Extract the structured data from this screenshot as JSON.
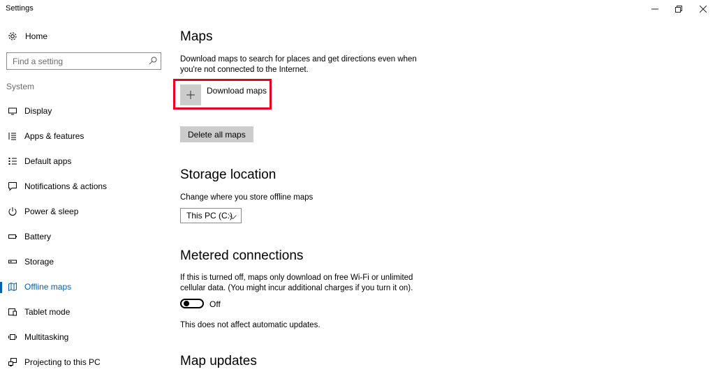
{
  "window": {
    "title": "Settings",
    "controls": {
      "minimize": "—",
      "maximize": "🗗",
      "close": "✕"
    }
  },
  "sidebar": {
    "home_label": "Home",
    "search_placeholder": "Find a setting",
    "section_label": "System",
    "items": [
      {
        "label": "Display",
        "icon": "display-icon"
      },
      {
        "label": "Apps & features",
        "icon": "apps-features-icon"
      },
      {
        "label": "Default apps",
        "icon": "default-apps-icon"
      },
      {
        "label": "Notifications & actions",
        "icon": "notifications-icon"
      },
      {
        "label": "Power & sleep",
        "icon": "power-icon"
      },
      {
        "label": "Battery",
        "icon": "battery-icon"
      },
      {
        "label": "Storage",
        "icon": "storage-icon"
      },
      {
        "label": "Offline maps",
        "icon": "offline-maps-icon",
        "active": true
      },
      {
        "label": "Tablet mode",
        "icon": "tablet-mode-icon"
      },
      {
        "label": "Multitasking",
        "icon": "multitasking-icon"
      },
      {
        "label": "Projecting to this PC",
        "icon": "projecting-icon"
      }
    ]
  },
  "main": {
    "maps": {
      "heading": "Maps",
      "description": "Download maps to search for places and get directions even when you're not connected to the Internet.",
      "download_label": "Download maps",
      "delete_label": "Delete all maps"
    },
    "storage": {
      "heading": "Storage location",
      "description": "Change where you store offline maps",
      "selected_drive": "This PC (C:)"
    },
    "metered": {
      "heading": "Metered connections",
      "description": "If this is turned off, maps only download on free Wi-Fi or unlimited cellular data. (You might incur additional charges if you turn it on).",
      "toggle_state": "Off",
      "note": "This does not affect automatic updates."
    },
    "updates": {
      "heading": "Map updates"
    }
  },
  "colors": {
    "accent": "#0063b1",
    "highlight_box": "#e8001c",
    "button_gray": "#cccccc"
  }
}
